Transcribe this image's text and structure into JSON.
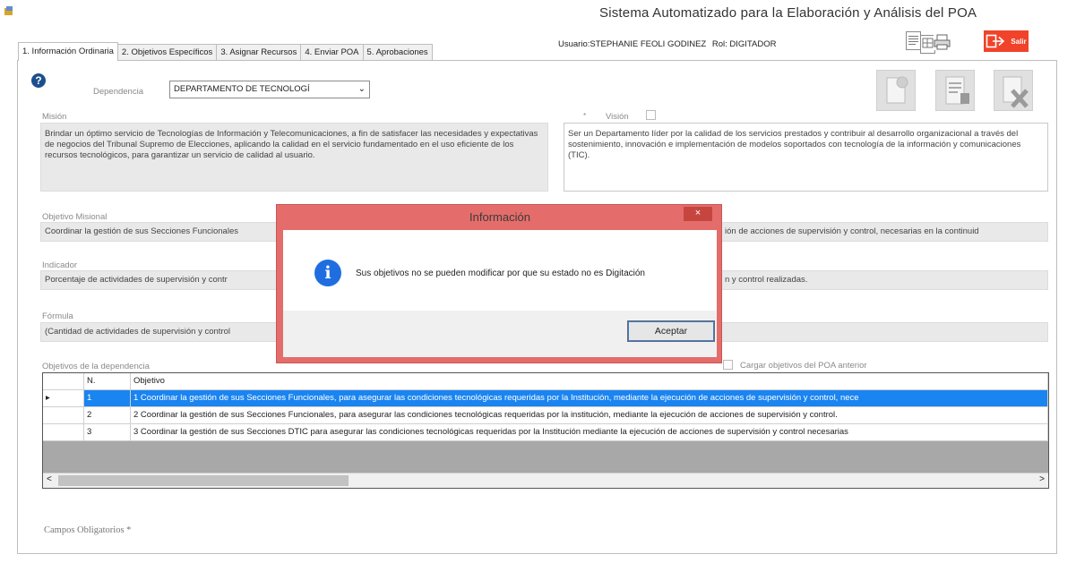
{
  "window": {
    "title": "Sistema Automatizado para la Elaboración y Análisis del POA"
  },
  "tabs": [
    {
      "label": "1. Información Ordinaria",
      "active": true
    },
    {
      "label": "2. Objetivos Específicos"
    },
    {
      "label": "3. Asignar Recursos"
    },
    {
      "label": "4. Enviar POA"
    },
    {
      "label": "5. Aprobaciones"
    }
  ],
  "user": {
    "usuario": "Usuario:STEPHANIE FEOLI GODINEZ",
    "rol": "Rol: DIGITADOR"
  },
  "toolbar": {
    "salir_label": "Salir"
  },
  "form": {
    "help_glyph": "?",
    "dependencia_label": "Dependencia",
    "dependencia_value": "DEPARTAMENTO DE TECNOLOGÍ",
    "mision_label": "Misión",
    "mision_text": "Brindar un óptimo servicio de Tecnologías de Información y Telecomunicaciones, a fin de satisfacer las necesidades y expectativas de negocios del Tribunal Supremo de Elecciones, aplicando la calidad en el servicio fundamentado en el uso eficiente de los recursos tecnológicos, para garantizar un servicio de calidad al usuario.",
    "vision_label": "Visión",
    "vision_required": "*",
    "vision_text": "Ser un Departamento líder por la calidad de los servicios prestados y contribuir al desarrollo organizacional a través del sostenimiento, innovación e implementación de modelos soportados con tecnología de la información y comunicaciones (TIC).",
    "objetivo_label": "Objetivo Misional",
    "objetivo_left": "Coordinar la gestión de sus Secciones Funcionales",
    "objetivo_right": "ión de acciones de supervisión y control, necesarias en la continuid",
    "indicador_label": "Indicador",
    "indicador_left": "Porcentaje de actividades de supervisión y contr",
    "indicador_right": "n y control realizadas.",
    "formula_label": "Fórmula",
    "formula_left": "(Cantidad de actividades de supervisión y control",
    "formula_right": "",
    "objetivos_label": "Objetivos de la dependencia",
    "cargar_label": "Cargar objetivos del POA anterior",
    "campos_label": "Campos Obligatorios *"
  },
  "grid": {
    "columns": [
      "",
      "N.",
      "Objetivo"
    ],
    "rows": [
      {
        "marker": "▸",
        "n": "1",
        "objetivo": "1 Coordinar la gestión de sus Secciones Funcionales, para asegurar las condiciones tecnológicas requeridas por la Institución, mediante la ejecución de acciones de supervisión y control, nece",
        "selected": true
      },
      {
        "marker": "",
        "n": "2",
        "objetivo": "2 Coordinar la gestión de sus Secciones Funcionales, para asegurar las condiciones tecnológicas requeridas por la institución, mediante la ejecución de acciones de supervisión y control."
      },
      {
        "marker": "",
        "n": "3",
        "objetivo": "3 Coordinar la gestión de sus Secciones DTIC para asegurar las condiciones tecnológicas requeridas por la Institución mediante la ejecución de acciones de supervisión y control necesarias"
      }
    ],
    "scroll_left": "<",
    "scroll_right": ">"
  },
  "dialog": {
    "title": "Información",
    "close_glyph": "×",
    "info_glyph": "i",
    "message": "Sus objetivos no se pueden modificar por que su estado no es Digitación",
    "ok_label": "Aceptar"
  },
  "colors": {
    "accent": "#1a84f0",
    "salir": "#f0432a",
    "dialog_border": "#e46d6b"
  }
}
